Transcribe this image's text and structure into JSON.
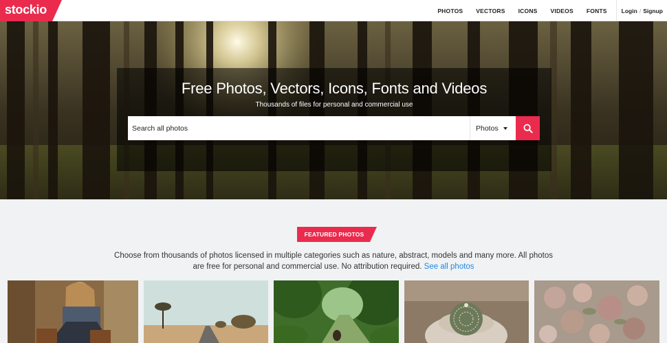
{
  "brand": {
    "name": "stockio",
    "color": "#ea2b4e"
  },
  "nav": {
    "items": [
      {
        "label": "PHOTOS"
      },
      {
        "label": "VECTORS"
      },
      {
        "label": "ICONS"
      },
      {
        "label": "VIDEOS"
      },
      {
        "label": "FONTS"
      }
    ],
    "login": "Login",
    "separator": "/",
    "signup": "Signup"
  },
  "hero": {
    "title": "Free Photos, Vectors, Icons, Fonts and Videos",
    "subtitle": "Thousands of files for personal and commercial use",
    "search": {
      "placeholder": "Search all photos",
      "value": ""
    },
    "type_select": {
      "selected": "Photos"
    },
    "search_icon": "search-icon"
  },
  "featured": {
    "badge": "FEATURED PHOTOS",
    "description": "Choose from thousands of photos licensed in multiple categories such as nature, abstract, models and many more. All photos are free for personal and commercial use. No attribution required.",
    "see_all": "See all photos",
    "thumbnails": [
      {
        "subject": "woman-with-boots"
      },
      {
        "subject": "desert-road-with-tree"
      },
      {
        "subject": "green-forest-path"
      },
      {
        "subject": "cactus-in-pot"
      },
      {
        "subject": "dried-roses"
      }
    ]
  },
  "colors": {
    "accent": "#ea2b4e",
    "link": "#1e88e5",
    "page_bg": "#f1f2f3"
  }
}
